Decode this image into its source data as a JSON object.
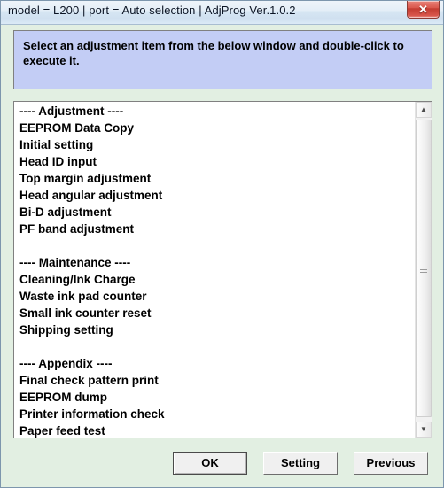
{
  "window": {
    "title": "model = L200 | port = Auto selection | AdjProg Ver.1.0.2",
    "background_color": "#e2efe2",
    "close_label": "✕"
  },
  "instruction": {
    "text": "Select an adjustment item from the below window and double-click to execute it."
  },
  "list": {
    "items": [
      "---- Adjustment ----",
      "EEPROM Data Copy",
      "Initial setting",
      "Head ID input",
      "Top margin adjustment",
      "Head angular adjustment",
      "Bi-D adjustment",
      "PF band adjustment",
      "",
      "---- Maintenance ----",
      "Cleaning/Ink Charge",
      "Waste ink pad counter",
      "Small ink counter reset",
      "Shipping setting",
      "",
      "---- Appendix ----",
      "Final check pattern print",
      "EEPROM dump",
      "Printer information check",
      "Paper feed test"
    ],
    "scroll": {
      "up_arrow": "▲",
      "down_arrow": "▼"
    }
  },
  "buttons": {
    "ok": "OK",
    "setting": "Setting",
    "previous": "Previous"
  }
}
